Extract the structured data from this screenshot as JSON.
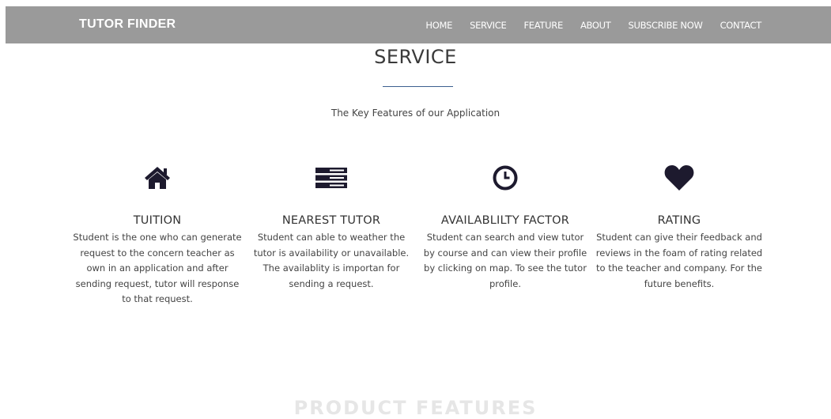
{
  "navbar": {
    "brand": "TUTOR FINDER",
    "links": [
      "HOME",
      "SERVICE",
      "FEATURE",
      "ABOUT",
      "SUBSCRIBE NOW",
      "CONTACT"
    ]
  },
  "service": {
    "title": "SERVICE",
    "subtitle": "The Key Features of our Application",
    "features": [
      {
        "icon": "home-icon",
        "title": "TUITION",
        "text": "Student is the one who can generate request to the concern teacher as own in an application and after sending request, tutor will response to that request."
      },
      {
        "icon": "server-icon",
        "title": "NEAREST TUTOR",
        "text": "Student can able to weather the tutor is availability or unavailable. The availablity is importan for sending a request."
      },
      {
        "icon": "clock-icon",
        "title": "AVAILABLILTY FACTOR",
        "text": "Student can search and view tutor by course and can view their profile by clicking on map. To see the tutor profile."
      },
      {
        "icon": "heart-icon",
        "title": "RATING",
        "text": "Student can give their feedback and reviews in the foam of rating related to the teacher and company. For the future benefits."
      }
    ]
  },
  "next_section": {
    "title": "PRODUCT FEATURES"
  },
  "colors": {
    "navbar_bg": "#9a9a9a",
    "icon": "#1d1a2e",
    "title_rule": "#3b5f8f"
  }
}
